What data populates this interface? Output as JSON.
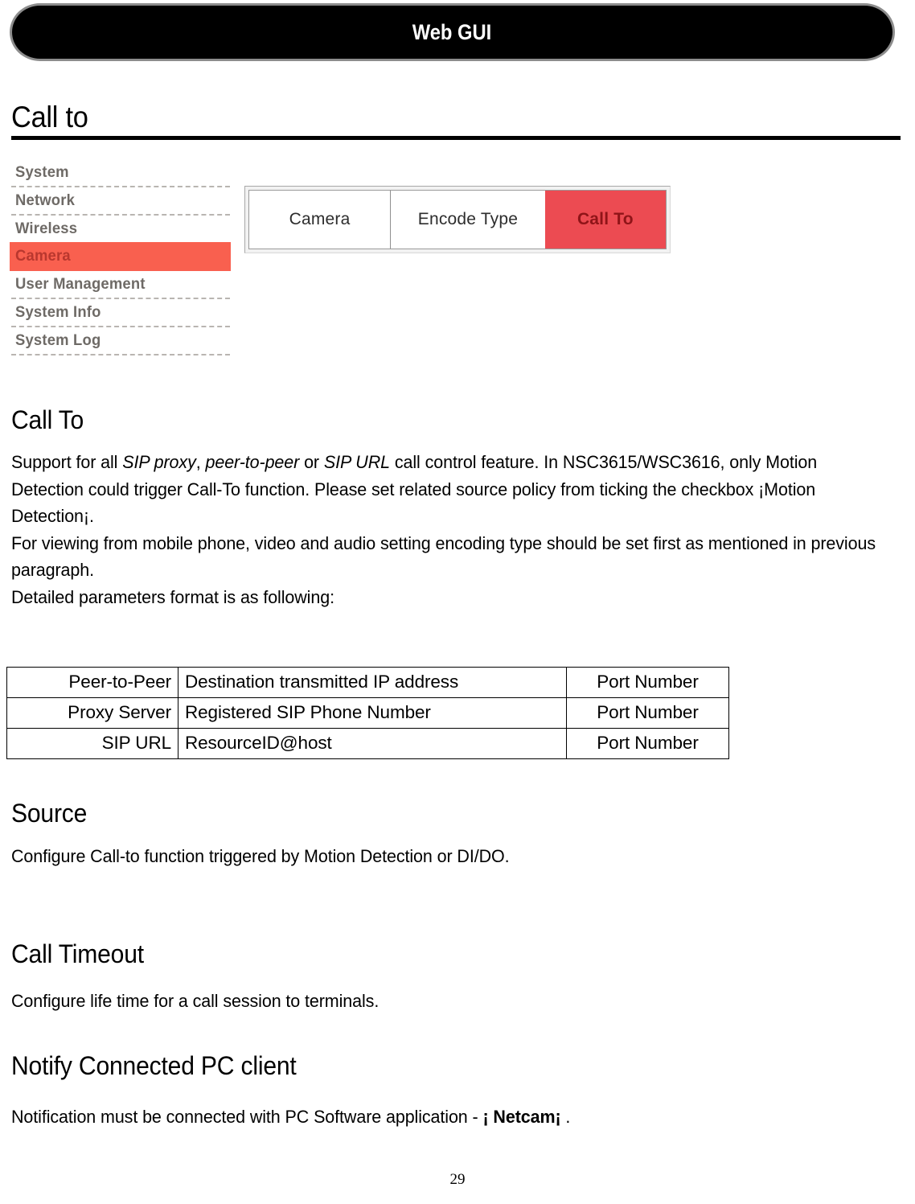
{
  "header": {
    "title": "Web GUI"
  },
  "section_heading": {
    "title": "Call to"
  },
  "gui_figure": {
    "sidebar": {
      "items": [
        {
          "label": "System",
          "active": false
        },
        {
          "label": "Network",
          "active": false
        },
        {
          "label": "Wireless",
          "active": false
        },
        {
          "label": "Camera",
          "active": true
        },
        {
          "label": "User Management",
          "active": false
        },
        {
          "label": "System Info",
          "active": false
        },
        {
          "label": "System Log",
          "active": false
        }
      ],
      "active_color": "#f9604f",
      "active_text_color": "#b9372e",
      "label_color": "#6e6a66"
    },
    "tabs": [
      {
        "label": "Camera",
        "active": false
      },
      {
        "label": "Encode Type",
        "active": false
      },
      {
        "label": "Call To",
        "active": true
      }
    ],
    "tab_active_color": "#ec4b52",
    "tab_active_text_color": "#8f1418"
  },
  "sections": {
    "call_to": {
      "heading": "Call To",
      "paragraph_parts": {
        "p1_a": "Support for all ",
        "p1_i1": "SIP proxy",
        "p1_b": ", ",
        "p1_i2": "peer-to-peer",
        "p1_c": " or ",
        "p1_i3": "SIP URL",
        "p1_d": " call control feature. In NSC3615/WSC3616, only Motion Detection could trigger Call-To function. Please set related source policy from ticking the checkbox ¡Motion Detection¡.",
        "p2": "For viewing from mobile phone, video and audio setting encoding type should be set first as mentioned in previous paragraph.",
        "p3": "Detailed parameters format is as following:"
      }
    },
    "source": {
      "heading": "Source",
      "paragraph": "Configure Call-to function triggered by Motion Detection or DI/DO."
    },
    "call_timeout": {
      "heading": "Call Timeout",
      "paragraph": "Configure life time for a call session to terminals."
    },
    "notify": {
      "heading": "Notify Connected PC client",
      "paragraph_parts": {
        "a": "Notification must be connected with PC Software application - ",
        "bold": "¡ Netcam¡",
        "b": " ."
      }
    }
  },
  "param_table": {
    "rows": [
      {
        "name": "Peer-to-Peer",
        "description": "Destination transmitted IP address",
        "port": "Port Number"
      },
      {
        "name": "Proxy Server",
        "description": "Registered SIP Phone Number",
        "port": "Port Number"
      },
      {
        "name": "SIP URL",
        "description": "ResourceID@host",
        "port": "Port Number"
      }
    ]
  },
  "footer": {
    "page_number": "29"
  }
}
